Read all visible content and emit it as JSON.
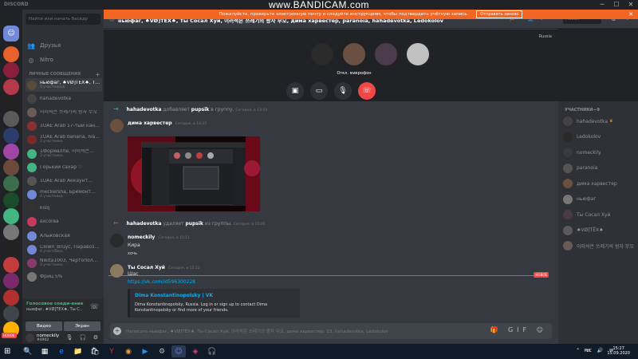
{
  "watermark": {
    "prefix": "www.",
    "brand": "BANDICAM",
    "suffix": ".com"
  },
  "app": {
    "name": "DISCORD"
  },
  "window_controls": {
    "min": "─",
    "max": "☐",
    "close": "✕"
  },
  "notice": {
    "text": "Пожалуйста, проверьте электронную почту и следуйте инструкциям, чтобы подтвердить учётную запись.",
    "button": "Отправить заново",
    "close": "✕"
  },
  "sidebar": {
    "search_placeholder": "Найти или начать беседу",
    "nav": [
      {
        "label": "Друзья",
        "icon": "👥"
      },
      {
        "label": "Nitro",
        "icon": "◎"
      }
    ],
    "dm_header": "ЛИЧНЫЕ СООБЩЕНИЯ",
    "dm_add": "+",
    "dms": [
      {
        "name": "ньюфаг, ♠VØ]ΤĒX♠, Ты С…",
        "sub": "9 участников",
        "color": "#5a4a3a",
        "active": true
      },
      {
        "name": "hahadevotka",
        "sub": "",
        "color": "#444",
        "active": false
      },
      {
        "name": "이러석은 쓰레기의 왕자 무오",
        "sub": "",
        "color": "#6a5a55",
        "active": false
      },
      {
        "name": "1UAE Arab 17-тый канал",
        "sub": "",
        "color": "#8a3030",
        "active": false
      },
      {
        "name": "1UAE Arab banana, Ivan…",
        "sub": "3 участника",
        "color": "#7a2a2a",
        "active": false
      },
      {
        "name": "1Формалпе, 이러석은…",
        "sub": "3 участника",
        "color": "#43b581",
        "active": false
      },
      {
        "name": "Горький сахар ♡",
        "sub": "",
        "color": "#43b581",
        "active": false
      },
      {
        "name": "1UAE Arab Аккаунт…",
        "sub": "",
        "color": "#555",
        "active": false
      },
      {
        "name": "meckersha, Бремонт…",
        "sub": "4 участника",
        "color": "#7289da",
        "active": false
      },
      {
        "name": "kisq",
        "sub": "",
        "color": "#333",
        "active": false
      },
      {
        "name": "excorea",
        "sub": "",
        "color": "#c43c5a",
        "active": false
      },
      {
        "name": "Алыковская",
        "sub": "",
        "color": "#7289da",
        "active": false
      },
      {
        "name": "Clown_Bruyc, Паравоз…",
        "sub": "4 участника",
        "color": "#7289da",
        "active": false
      },
      {
        "name": "Nikita1003, Чертополох…",
        "sub": "3 участника",
        "color": "#8a3a6a",
        "active": false
      },
      {
        "name": "Фриц 5%",
        "sub": "",
        "color": "#777",
        "active": false
      }
    ],
    "voice": {
      "status": "Голосовое соеди-ение",
      "channel": "ньюфаг, ♠VØ]ΤĒX♠, Ты С…",
      "hangup_icon": "☏",
      "video_label": "Видео",
      "screen_label": "Экран"
    },
    "user": {
      "name": "nomeckily",
      "tag": "#4902",
      "controls": "🎙 🎧 ⚙"
    }
  },
  "guilds": {
    "home_icon": "☺",
    "items": [
      {
        "color": "#e9622b",
        "badge": ""
      },
      {
        "color": "#8a1f3c",
        "badge": ""
      },
      {
        "color": "#b33a4a",
        "badge": ""
      },
      {
        "color": "#222",
        "badge": ""
      },
      {
        "color": "#5a5a5a",
        "badge": ""
      },
      {
        "color": "#2c3c6c",
        "badge": ""
      },
      {
        "color": "#a046a6",
        "badge": ""
      },
      {
        "color": "#6b4a3b",
        "badge": ""
      },
      {
        "color": "#3c6c4c",
        "badge": ""
      },
      {
        "color": "#1a4c2a",
        "badge": ""
      },
      {
        "color": "#43b581",
        "badge": ""
      },
      {
        "color": "#777",
        "badge": ""
      },
      {
        "color": "#222",
        "badge": ""
      },
      {
        "color": "#c43c3c",
        "badge": ""
      },
      {
        "color": "#7a2a6a",
        "badge": ""
      },
      {
        "color": "#b03030",
        "badge": ""
      },
      {
        "color": "#40444b",
        "badge": ""
      },
      {
        "color": "#ffb000",
        "badge": ""
      }
    ],
    "new_label": "НОВОЕ"
  },
  "header": {
    "at": "@",
    "title": "ньюфаг, ♠VØ]ΤĒX♠, Ты Сосал Хуй, 이러석은 쓰레기의 왕자 무오, дима харвестер, paranoia, hahadevotka, Ledokolov",
    "icons": "📌 👤+ ",
    "search": "Поиск",
    "right_icons": "@ ?"
  },
  "call": {
    "region": "Russia",
    "avatars": [
      {
        "color": "#2a2a2a",
        "label": ""
      },
      {
        "color": "#6a5040",
        "label": "Откл. микрофон"
      },
      {
        "color": "#4a3a4a",
        "label": ""
      },
      {
        "color": "#c0c0c0",
        "label": ""
      }
    ],
    "buttons": [
      "▣",
      "▭",
      "🎙",
      "☏"
    ]
  },
  "messages": {
    "sys1": {
      "user": "hahadevotka",
      "verb": "добавляет",
      "target": "pupsik",
      "suffix": "в группу.",
      "time": "Сегодня, в 13:59"
    },
    "m1": {
      "author": "дима харвестер",
      "time": "Сегодня, в 14:15"
    },
    "sys2": {
      "user": "hahadevotka",
      "verb": "удаляет",
      "target": "pupsik",
      "suffix": "из группы.",
      "time": "Сегодня, в 15:00"
    },
    "m2": {
      "author": "nomeckily",
      "time": "Сегодня, в 15:11",
      "lines": [
        "Кира",
        "хочь"
      ]
    },
    "m3": {
      "author": "Ты Сосал Хуй",
      "time": "Сегодня, в 15:12",
      "lines": [
        "Щас"
      ]
    },
    "new_label": "НОВОЕ",
    "link": "https://vk.com/id596300228",
    "embed": {
      "title": "Dima Konstantinopolsky | VK",
      "desc": "Dima Konstantinopolsky, Russia. Log in or sign up to contact Dima Konstantinopolsky or find more of your friends."
    }
  },
  "composer": {
    "plus": "+",
    "placeholder": "Написать ньюфаг, ♠VØ]ΤĒX♠, Ты Сосал Хуй, 이러석은 쓰레기의 왕자 무오, дима харвестер, 13, hahadevotka, Ledokolov",
    "icons": "🎁 GIF ☺"
  },
  "members": {
    "header": "УЧАСТНИКИ—9",
    "list": [
      {
        "name": "hahadevotka",
        "crown": "♛",
        "color": "#444"
      },
      {
        "name": "Ledokolov",
        "crown": "",
        "color": "#2a2a2a"
      },
      {
        "name": "nomeckily",
        "crown": "",
        "color": "#3a3a3a"
      },
      {
        "name": "paranoia",
        "crown": "",
        "color": "#555"
      },
      {
        "name": "дима харвестер",
        "crown": "",
        "color": "#6a5040"
      },
      {
        "name": "ньюфаг",
        "crown": "",
        "color": "#777"
      },
      {
        "name": "Ты Сосал Хуй",
        "crown": "",
        "color": "#4a3a4a"
      },
      {
        "name": "♠VØ]ΤĒX♠",
        "crown": "",
        "color": "#5a5a5a"
      },
      {
        "name": "이러석은 쓰레기의 왕자 무오",
        "crown": "",
        "color": "#6a5a55"
      }
    ]
  },
  "taskbar": {
    "start": "⊞",
    "apps": [
      "🔍",
      "▦",
      "e",
      "📁",
      "🛍",
      "Y",
      "◉",
      "▶",
      "⚙",
      "☺",
      "◈",
      "🎧"
    ],
    "tray": "⌃ ▭ 🔊 ✉",
    "lang": "РУС",
    "time": "15:27",
    "date": "15.09.2020"
  }
}
